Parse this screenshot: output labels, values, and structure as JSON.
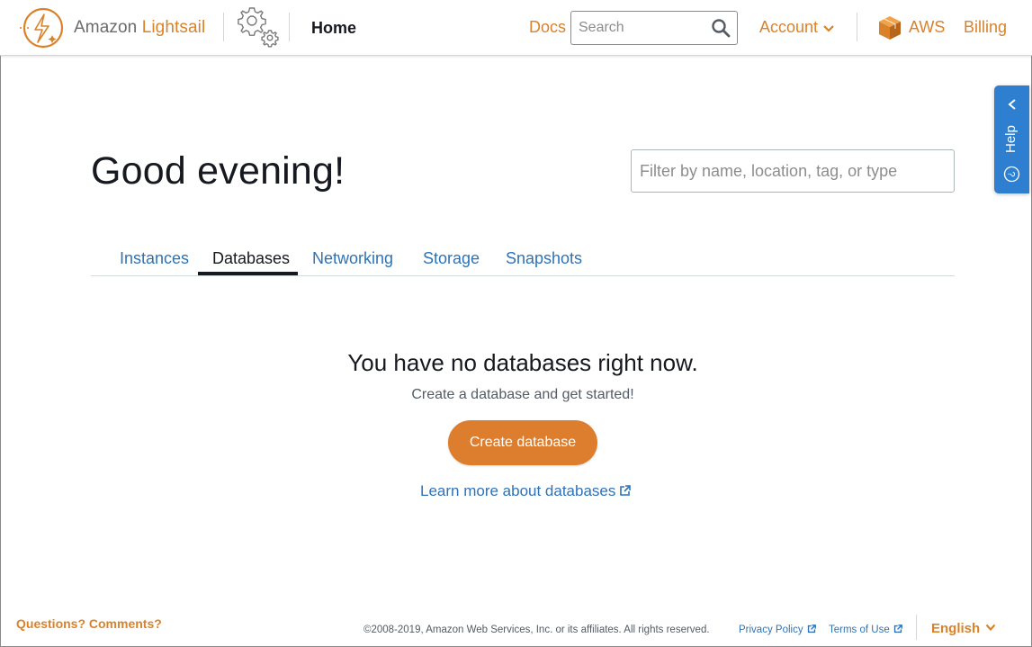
{
  "header": {
    "brand_prefix": "Amazon ",
    "brand_accent": "Lightsail",
    "home_label": "Home",
    "docs_label": "Docs",
    "search_placeholder": "Search",
    "account_label": "Account",
    "aws_label": "AWS",
    "billing_label": "Billing"
  },
  "help": {
    "label": "Help"
  },
  "main": {
    "greeting": "Good evening!",
    "filter_placeholder": "Filter by name, location, tag, or type",
    "tabs": [
      {
        "label": "Instances",
        "active": false
      },
      {
        "label": "Databases",
        "active": true
      },
      {
        "label": "Networking",
        "active": false
      },
      {
        "label": "Storage",
        "active": false
      },
      {
        "label": "Snapshots",
        "active": false
      }
    ],
    "empty_title": "You have no databases right now.",
    "empty_subtitle": "Create a database and get started!",
    "create_button": "Create database",
    "learn_more": "Learn more about databases"
  },
  "footer": {
    "questions": "Questions? Comments?",
    "copyright": "©2008-2019, Amazon Web Services, Inc. or its affiliates. All rights reserved.",
    "privacy": "Privacy Policy",
    "terms": "Terms of Use",
    "language": "English"
  },
  "colors": {
    "brand_orange": "#d9822b",
    "button_orange": "#dd7d2e",
    "link_blue": "#2e73b8",
    "help_blue": "#2e7fcf",
    "text_dark": "#16191f"
  },
  "icons": [
    "lightsail-logo-icon",
    "gear-icon",
    "search-icon",
    "chevron-down-icon",
    "aws-box-icon",
    "chevron-left-icon",
    "help-circle-icon",
    "external-link-icon"
  ]
}
